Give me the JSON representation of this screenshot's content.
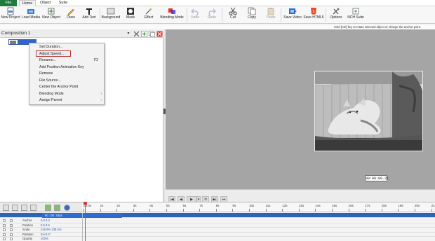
{
  "menu": {
    "tabs": [
      "File",
      "Home",
      "Object",
      "Suite"
    ]
  },
  "toolbar": {
    "buttons": [
      {
        "label": "New Project",
        "icon": "new-project-icon"
      },
      {
        "label": "Load Media",
        "icon": "load-media-icon"
      },
      {
        "label": "New Object",
        "icon": "new-object-icon"
      },
      {
        "label": "Draw",
        "icon": "draw-icon"
      },
      {
        "label": "Add Text",
        "icon": "text-icon"
      },
      {
        "label": "Background",
        "icon": "background-icon"
      },
      {
        "label": "Mask",
        "icon": "mask-icon"
      },
      {
        "label": "Effect",
        "icon": "effect-icon"
      },
      {
        "label": "Blending Mode",
        "icon": "blending-icon"
      },
      {
        "label": "Undo",
        "icon": "undo-icon"
      },
      {
        "label": "Redo",
        "icon": "redo-icon"
      },
      {
        "label": "Cut",
        "icon": "cut-icon"
      },
      {
        "label": "Copy",
        "icon": "copy-icon"
      },
      {
        "label": "Paste",
        "icon": "paste-icon"
      },
      {
        "label": "Save Video",
        "icon": "save-video-icon"
      },
      {
        "label": "Save HTML5",
        "icon": "html5-icon"
      },
      {
        "label": "Options",
        "icon": "options-icon"
      },
      {
        "label": "NCH Suite",
        "icon": "nch-suite-icon"
      }
    ]
  },
  "hint": "Hold [Ctrl] key to rotate selected object or change the anchor point.",
  "composition": {
    "title": "Composition 1"
  },
  "context_menu": {
    "items": [
      {
        "label": "Set Duration...",
        "shortcut": "",
        "submenu": false
      },
      {
        "label": "Adjust Speed...",
        "shortcut": "",
        "submenu": false
      },
      {
        "label": "Rename...",
        "shortcut": "F2",
        "submenu": false
      },
      {
        "label": "Add Position Animation Key",
        "shortcut": "",
        "submenu": false
      },
      {
        "label": "Remove",
        "shortcut": "",
        "submenu": false
      },
      {
        "label": "File Source...",
        "shortcut": "",
        "submenu": false
      },
      {
        "label": "Center the Anchor Point",
        "shortcut": "",
        "submenu": false
      },
      {
        "label": "Blending Mode",
        "shortcut": "",
        "submenu": true
      },
      {
        "label": "Assign Parent",
        "shortcut": "",
        "submenu": true
      }
    ]
  },
  "preview": {
    "timecode": "00:00:00.21"
  },
  "transport": {
    "buttons": [
      "|◀",
      "◀",
      "▶",
      "▾",
      "⟲",
      "▶|",
      "⏭"
    ]
  },
  "timeline": {
    "ruler_labels": [
      "00.0s",
      "1s",
      "2s",
      "3s",
      "4s",
      "5s",
      "6s",
      "7s",
      "8s",
      "9s",
      "10s",
      "11s",
      "12s",
      "13s",
      "14s",
      "15s",
      "16s",
      "17s",
      "18s",
      "19s",
      "20s",
      "21s"
    ],
    "clip_info": "00 : 00 : 05.8",
    "tracks": [
      {
        "name": "Anchor",
        "value": "0.0    0.0"
      },
      {
        "name": "Position",
        "value": "0.5    0.5"
      },
      {
        "name": "Scale",
        "value": "445.9%   238.4%"
      },
      {
        "name": "Rotation",
        "value": "0x+0.0°"
      },
      {
        "name": "Opacity",
        "value": "100%"
      }
    ]
  },
  "colors": {
    "accent": "#2f6bd1",
    "file_tab": "#1e7a3e",
    "highlight_border": "#c0392b",
    "playhead": "#d43c3c"
  }
}
